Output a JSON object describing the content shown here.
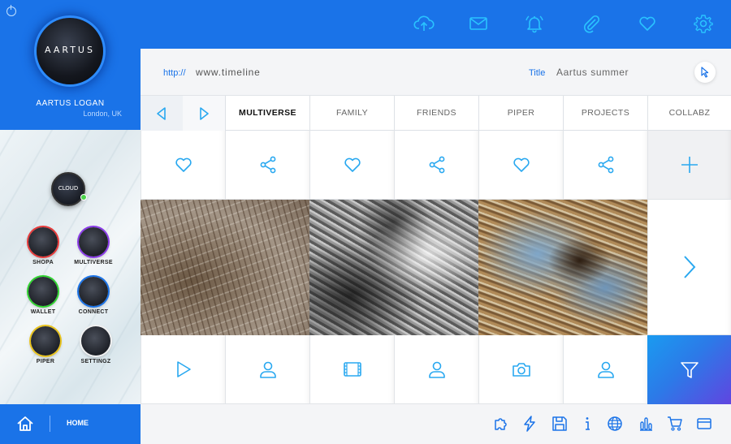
{
  "profile": {
    "logo_text": "AARTUS",
    "name": "AARTUS LOGAN",
    "location": "London, UK"
  },
  "apps": {
    "cloud_label": "CLOUD",
    "items": [
      {
        "label": "SHOPA",
        "ring": "#e83a3a"
      },
      {
        "label": "MULTIVERSE",
        "ring": "#8a3ae8"
      },
      {
        "label": "WALLET",
        "ring": "#2fd32f"
      },
      {
        "label": "CONNECT",
        "ring": "#1a73e8"
      },
      {
        "label": "PIPER",
        "ring": "#e8c21a"
      },
      {
        "label": "SETTINGZ",
        "ring": "#f0f0f0"
      }
    ]
  },
  "home": {
    "label": "HOME"
  },
  "topbar": {
    "icons": [
      "cloud-upload-icon",
      "mail-icon",
      "bell-icon",
      "paperclip-icon",
      "heart-icon",
      "gear-icon"
    ]
  },
  "address": {
    "protocol": "http://",
    "url": "www.timeline",
    "title_label": "Title",
    "title_value": "Aartus summer"
  },
  "tabs": [
    "MULTIVERSE",
    "FAMILY",
    "FRIENDS",
    "PIPER",
    "PROJECTS",
    "COLLABZ"
  ],
  "active_tab": "MULTIVERSE",
  "action_row": [
    "heart-icon",
    "share-icon",
    "heart-icon",
    "share-icon",
    "heart-icon",
    "share-icon",
    "plus-icon"
  ],
  "media_row": [
    "play-icon",
    "user-icon",
    "film-icon",
    "user-icon",
    "camera-icon",
    "user-icon",
    "filter-icon"
  ],
  "bottombar": {
    "icons": [
      "puzzle-icon",
      "bolt-icon",
      "save-icon",
      "info-icon",
      "globe-icon",
      "chart-icon",
      "cart-icon",
      "card-icon"
    ]
  },
  "colors": {
    "accent": "#1a73e8",
    "icon": "#29a8f0",
    "gradient_end": "#6045e0"
  }
}
